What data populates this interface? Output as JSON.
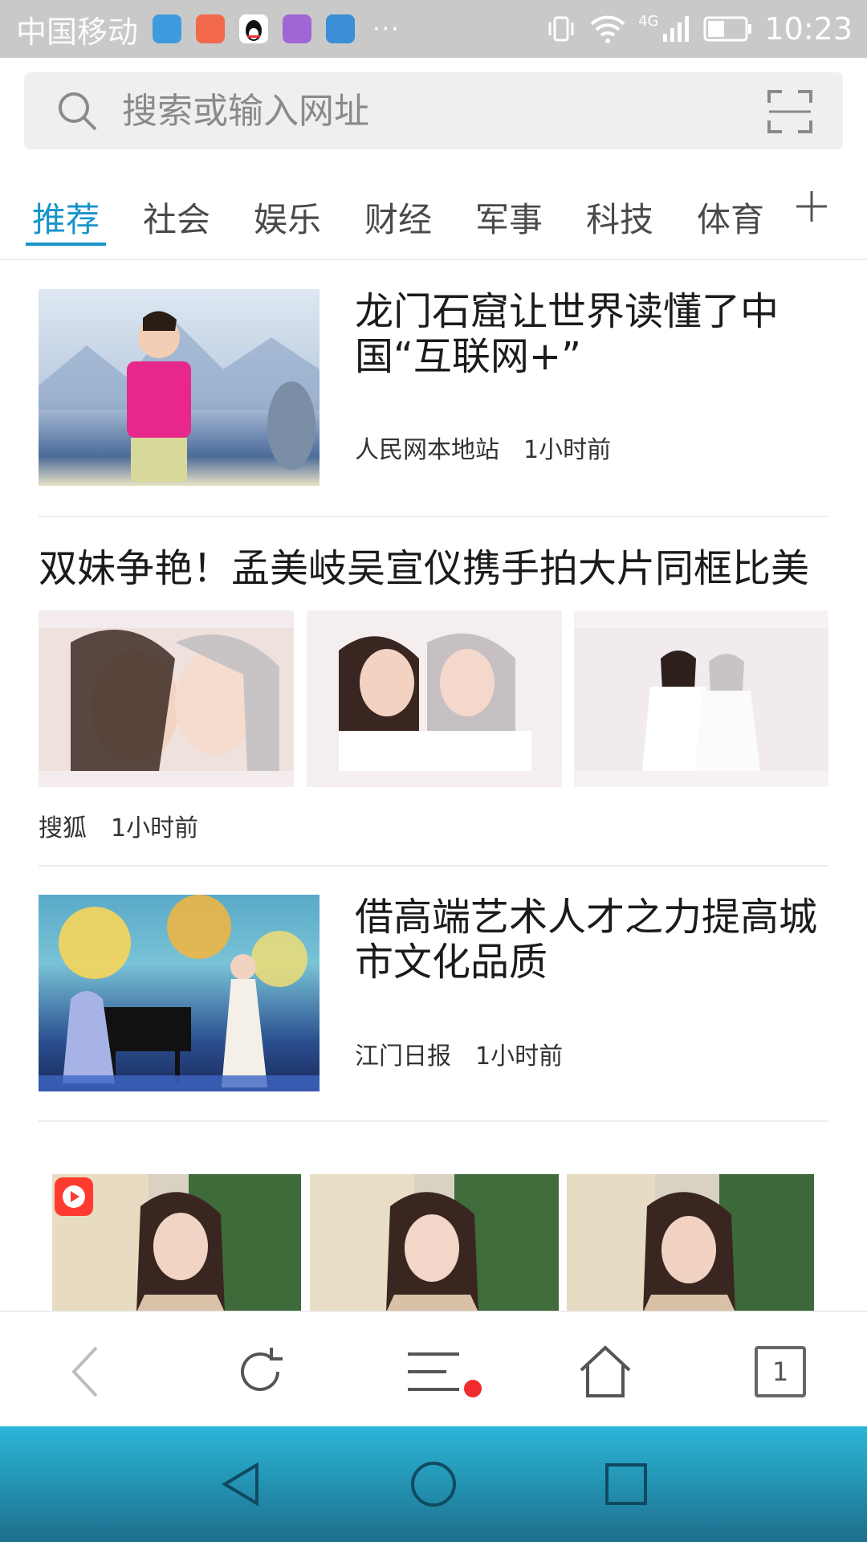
{
  "status_bar": {
    "carrier": "中国移动",
    "more": "···",
    "network": "4G",
    "time": "10:23"
  },
  "search": {
    "placeholder": "搜索或输入网址"
  },
  "tabs": [
    {
      "label": "推荐",
      "active": true
    },
    {
      "label": "社会"
    },
    {
      "label": "娱乐"
    },
    {
      "label": "财经"
    },
    {
      "label": "军事"
    },
    {
      "label": "科技"
    },
    {
      "label": "体育"
    }
  ],
  "articles": [
    {
      "title_line1": "龙门石窟让世界读懂了中",
      "title_line2": "国“互联网+”",
      "source": "人民网本地站",
      "time": "1小时前"
    },
    {
      "title": "双妹争艳！孟美岐吴宣仪携手拍大片同框比美",
      "source": "搜狐",
      "time": "1小时前"
    },
    {
      "title_line1": "借高端艺术人才之力提高城",
      "title_line2": "市文化品质",
      "source": "江门日报",
      "time": "1小时前"
    }
  ],
  "toolbar": {
    "tabs_count": "1"
  },
  "colors": {
    "accent": "#1794c9",
    "notification_dot": "#ef2b2b",
    "status_bar": "#c9c9c9"
  },
  "icons": [
    "search-icon",
    "scan-icon",
    "add-tab-icon",
    "back-icon",
    "refresh-icon",
    "menu-icon",
    "home-icon",
    "nav-back-icon",
    "nav-home-icon",
    "nav-recents-icon"
  ]
}
